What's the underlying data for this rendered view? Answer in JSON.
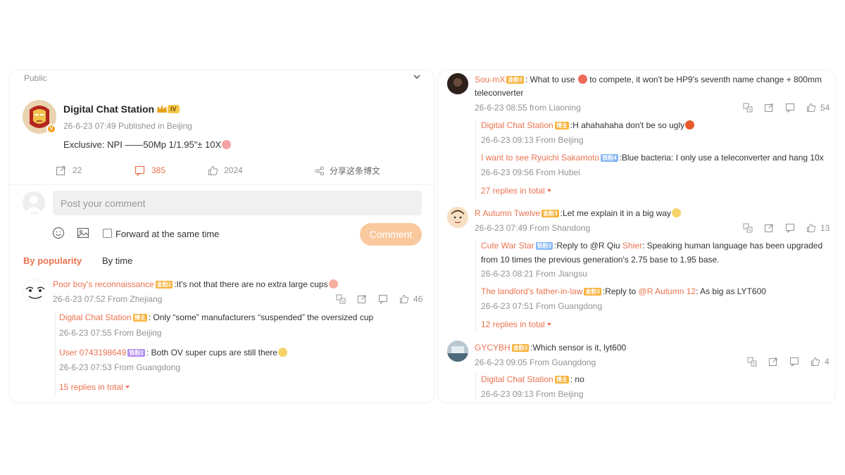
{
  "post": {
    "visibility": "Public",
    "author": "Digital Chat Station",
    "author_badge": "IV",
    "time_location": "26-6-23 07:49  Published in Beijing",
    "content": "Exclusive: NPI ——50Mp 1/1.95\"± 10X",
    "reposts": "22",
    "comments": "385",
    "likes": "2024",
    "share_label": "分享这条博文",
    "comment_placeholder": "Post your comment",
    "forward_label": "Forward at the same time",
    "comment_button": "Comment",
    "sort_popularity": "By popularity",
    "sort_time": "By time"
  },
  "left_comments": [
    {
      "user": "Poor boy's reconnaissance",
      "badge": "金粉2",
      "text": ":It's  not that there are no extra large cups",
      "meta": "26-6-23 07:52 From Zhejiang",
      "likes": "46",
      "replies": [
        {
          "user": "Digital Chat Station",
          "badge": "博主",
          "text": ": Only “some” manufacturers “suspended” the oversized cup",
          "meta": "26-6-23 07:55 From Beijing"
        },
        {
          "user": "User 0743198649",
          "badge": "铁粉2",
          "text": ":  Both OV super cups are still there",
          "meta": "26-6-23 07:53 From Guangdong"
        }
      ],
      "more": "15 replies in total"
    }
  ],
  "right_comments": [
    {
      "user": "Sou-mX",
      "badge": "金粉3",
      "text_a": ": What to use",
      "text_b": "to compete, it won't be HP9's seventh name change + 800mm",
      "text_c": "teleconverter",
      "meta": "26-6-23 08:55 from Liaoning",
      "likes": "54",
      "replies": [
        {
          "user": "Digital Chat Station",
          "badge": "博主",
          "text": ":H ahahahaha don't be so ugly",
          "meta": "26-6-23 09:13 From Beijing"
        },
        {
          "user": "I want to see Ryuichi Sakamoto",
          "badge": "铁粉4",
          "text": ":Blue  bacteria: I only use a teleconverter and hang 10x",
          "meta": "26-6-23 09:56 From Hubei"
        }
      ],
      "more": "27 replies in total"
    },
    {
      "user": "R Autumn Twelve",
      "badge": "金粉3",
      "text": ":Let  me explain it in a big way",
      "meta": "26-6-23 07:49 From Shandong",
      "likes": "13",
      "replies": [
        {
          "user": "Cute War Star",
          "badge": "铁粉3",
          "text_a": ":Reply to @R Qiu  ",
          "mention": "Shier",
          "text_b": ": Speaking human language has been upgraded",
          "text_c": "from 10 times the previous generation's 2.75 base to 1.95 base.",
          "meta": "26-6-23 08:21 From Jiangsu"
        },
        {
          "user": "The landlord's father-in-law",
          "badge": "金粉3",
          "text_a": ":Reply to ",
          "mention": "@R Autumn 12",
          "text_b": ": As big as LYT600",
          "meta": "26-6-23 07:51 From Guangdong"
        }
      ],
      "more": "12 replies in total"
    },
    {
      "user": "GYCYBH",
      "badge": "金粉3",
      "text": ":Which sensor  is it, lyt600",
      "meta": "26-6-23 09:05 From Guangdong",
      "likes": "4",
      "replies": [
        {
          "user": "Digital Chat Station",
          "badge": "博主",
          "text": ": no",
          "meta": "26-6-23 09:13 From Beijing"
        }
      ]
    }
  ]
}
